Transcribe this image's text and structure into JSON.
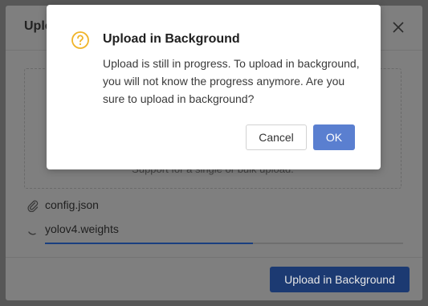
{
  "upload_modal": {
    "title": "Upload",
    "dropzone_hint": "Support for a single or bulk upload.",
    "files": [
      {
        "name": "config.json",
        "icon": "paperclip-icon"
      },
      {
        "name": "yolov4.weights",
        "icon": "loading-spinner-icon",
        "progress_fraction": 0.58
      }
    ],
    "primary_button": "Upload in Background"
  },
  "confirm_dialog": {
    "title": "Upload in Background",
    "message": "Upload is still in progress. To upload in background, you will not know the progress anymore. Are you sure to upload in background?",
    "cancel_label": "Cancel",
    "ok_label": "OK",
    "icon": "question-circle-icon"
  },
  "colors": {
    "overlay": "#575757",
    "warning": "#f0b429",
    "primary": "#5a7fd0",
    "progress": "#1a3f80"
  }
}
